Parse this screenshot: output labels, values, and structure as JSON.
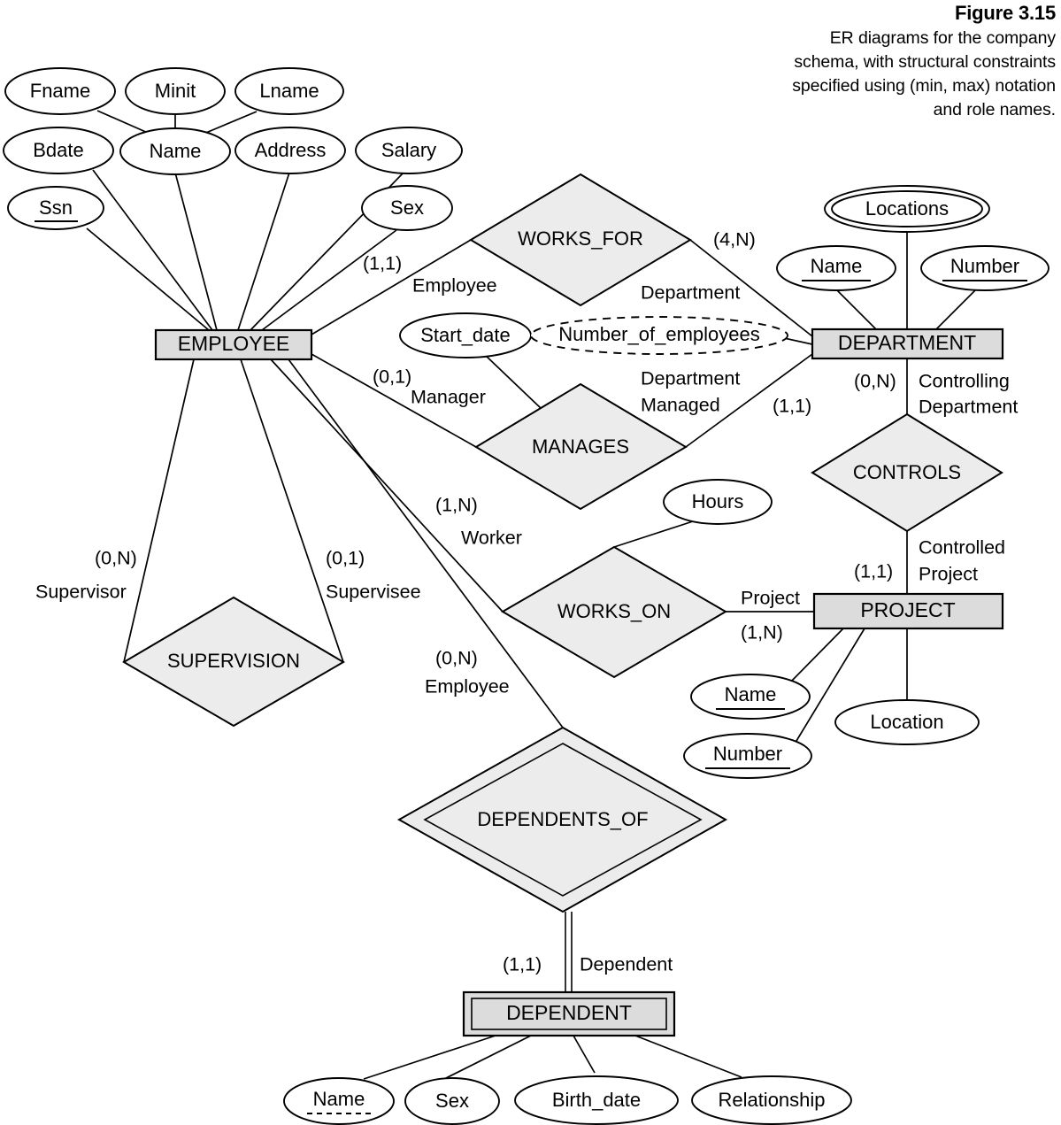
{
  "figure": {
    "number": "Figure 3.15",
    "caption_lines": [
      "ER diagrams for the company",
      "schema, with structural constraints",
      "specified using (min, max) notation",
      "and role names."
    ]
  },
  "colors": {
    "entity_fill": "#dcdcdc",
    "relationship_fill": "#ececec",
    "attribute_fill": "#ffffff",
    "stroke": "#000000",
    "background": "#ffffff"
  },
  "entities": [
    {
      "id": "employee",
      "label": "EMPLOYEE",
      "kind": "strong"
    },
    {
      "id": "department",
      "label": "DEPARTMENT",
      "kind": "strong"
    },
    {
      "id": "project",
      "label": "PROJECT",
      "kind": "strong"
    },
    {
      "id": "dependent",
      "label": "DEPENDENT",
      "kind": "weak"
    }
  ],
  "relationships": [
    {
      "id": "works_for",
      "label": "WORKS_FOR",
      "kind": "normal"
    },
    {
      "id": "manages",
      "label": "MANAGES",
      "kind": "normal"
    },
    {
      "id": "works_on",
      "label": "WORKS_ON",
      "kind": "normal"
    },
    {
      "id": "supervision",
      "label": "SUPERVISION",
      "kind": "normal"
    },
    {
      "id": "controls",
      "label": "CONTROLS",
      "kind": "normal"
    },
    {
      "id": "dependents_of",
      "label": "DEPENDENTS_OF",
      "kind": "identifying"
    }
  ],
  "attributes": {
    "employee": [
      {
        "id": "fname",
        "label": "Fname",
        "kind": "simple"
      },
      {
        "id": "minit",
        "label": "Minit",
        "kind": "simple"
      },
      {
        "id": "lname",
        "label": "Lname",
        "kind": "simple"
      },
      {
        "id": "name",
        "label": "Name",
        "kind": "composite"
      },
      {
        "id": "bdate",
        "label": "Bdate",
        "kind": "simple"
      },
      {
        "id": "address",
        "label": "Address",
        "kind": "simple"
      },
      {
        "id": "salary",
        "label": "Salary",
        "kind": "simple"
      },
      {
        "id": "ssn",
        "label": "Ssn",
        "kind": "key"
      },
      {
        "id": "sex",
        "label": "Sex",
        "kind": "simple"
      }
    ],
    "department": [
      {
        "id": "dept_name",
        "label": "Name",
        "kind": "key"
      },
      {
        "id": "dept_number",
        "label": "Number",
        "kind": "key"
      },
      {
        "id": "dept_locations",
        "label": "Locations",
        "kind": "multivalued"
      },
      {
        "id": "dept_numemp",
        "label": "Number_of_employees",
        "kind": "derived"
      }
    ],
    "project": [
      {
        "id": "proj_name",
        "label": "Name",
        "kind": "key"
      },
      {
        "id": "proj_number",
        "label": "Number",
        "kind": "key"
      },
      {
        "id": "proj_location",
        "label": "Location",
        "kind": "simple"
      }
    ],
    "dependent": [
      {
        "id": "dep_name",
        "label": "Name",
        "kind": "partial-key"
      },
      {
        "id": "dep_sex",
        "label": "Sex",
        "kind": "simple"
      },
      {
        "id": "dep_birth_date",
        "label": "Birth_date",
        "kind": "simple"
      },
      {
        "id": "dep_relationship",
        "label": "Relationship",
        "kind": "simple"
      }
    ],
    "works_for": [],
    "manages": [
      {
        "id": "start_date",
        "label": "Start_date",
        "kind": "simple"
      }
    ],
    "works_on": [
      {
        "id": "hours",
        "label": "Hours",
        "kind": "simple"
      }
    ]
  },
  "constraints": [
    {
      "id": "wf-emp",
      "relationship": "WORKS_FOR",
      "entity": "EMPLOYEE",
      "minmax": "(1,1)",
      "role": "Employee"
    },
    {
      "id": "wf-dept",
      "relationship": "WORKS_FOR",
      "entity": "DEPARTMENT",
      "minmax": "(4,N)",
      "role": "Department"
    },
    {
      "id": "mg-emp",
      "relationship": "MANAGES",
      "entity": "EMPLOYEE",
      "minmax": "(0,1)",
      "role": "Manager"
    },
    {
      "id": "mg-dept",
      "relationship": "MANAGES",
      "entity": "DEPARTMENT",
      "minmax": "(1,1)",
      "role": "Department Managed"
    },
    {
      "id": "wo-emp",
      "relationship": "WORKS_ON",
      "entity": "EMPLOYEE",
      "minmax": "(1,N)",
      "role": "Worker"
    },
    {
      "id": "wo-proj",
      "relationship": "WORKS_ON",
      "entity": "PROJECT",
      "minmax": "(1,N)",
      "role": "Project"
    },
    {
      "id": "sp-sup",
      "relationship": "SUPERVISION",
      "entity": "EMPLOYEE",
      "minmax": "(0,N)",
      "role": "Supervisor"
    },
    {
      "id": "sp-spe",
      "relationship": "SUPERVISION",
      "entity": "EMPLOYEE",
      "minmax": "(0,1)",
      "role": "Supervisee"
    },
    {
      "id": "ct-dept",
      "relationship": "CONTROLS",
      "entity": "DEPARTMENT",
      "minmax": "(0,N)",
      "role": "Controlling Department"
    },
    {
      "id": "ct-proj",
      "relationship": "CONTROLS",
      "entity": "PROJECT",
      "minmax": "(1,1)",
      "role": "Controlled Project"
    },
    {
      "id": "do-emp",
      "relationship": "DEPENDENTS_OF",
      "entity": "EMPLOYEE",
      "minmax": "(0,N)",
      "role": "Employee"
    },
    {
      "id": "do-dep",
      "relationship": "DEPENDENTS_OF",
      "entity": "DEPENDENT",
      "minmax": "(1,1)",
      "role": "Dependent"
    }
  ],
  "labels": {
    "employee": "EMPLOYEE",
    "department": "DEPARTMENT",
    "project": "PROJECT",
    "dependent": "DEPENDENT",
    "works_for": "WORKS_FOR",
    "manages": "MANAGES",
    "works_on": "WORKS_ON",
    "supervision": "SUPERVISION",
    "controls": "CONTROLS",
    "dependents_of": "DEPENDENTS_OF",
    "fname": "Fname",
    "minit": "Minit",
    "lname": "Lname",
    "name": "Name",
    "bdate": "Bdate",
    "address": "Address",
    "salary": "Salary",
    "ssn": "Ssn",
    "sex": "Sex",
    "start_date": "Start_date",
    "hours": "Hours",
    "dept_name": "Name",
    "dept_number": "Number",
    "dept_locations": "Locations",
    "dept_numemp": "Number_of_employees",
    "proj_name": "Name",
    "proj_number": "Number",
    "proj_location": "Location",
    "dep_name": "Name",
    "dep_sex": "Sex",
    "dep_birth_date": "Birth_date",
    "dep_relationship": "Relationship",
    "c_1_1_a": "(1,1)",
    "c_4_N": "(4,N)",
    "c_0_1": "(0,1)",
    "c_1_1_b": "(1,1)",
    "c_1_N_worker": "(1,N)",
    "c_0_N_sup": "(0,N)",
    "c_0_1_spe": "(0,1)",
    "c_0_N_emp": "(0,N)",
    "c_1_N_proj": "(1,N)",
    "c_0_N_dept": "(0,N)",
    "c_1_1_proj": "(1,1)",
    "c_1_1_dep": "(1,1)",
    "r_employee_wf": "Employee",
    "r_department_wf": "Department",
    "r_manager": "Manager",
    "r_dept_managed_1": "Department",
    "r_dept_managed_2": "Managed",
    "r_worker": "Worker",
    "r_supervisor": "Supervisor",
    "r_supervisee": "Supervisee",
    "r_employee_do": "Employee",
    "r_project": "Project",
    "r_controlling_1": "Controlling",
    "r_controlling_2": "Department",
    "r_controlled_1": "Controlled",
    "r_controlled_2": "Project",
    "r_dependent": "Dependent"
  }
}
